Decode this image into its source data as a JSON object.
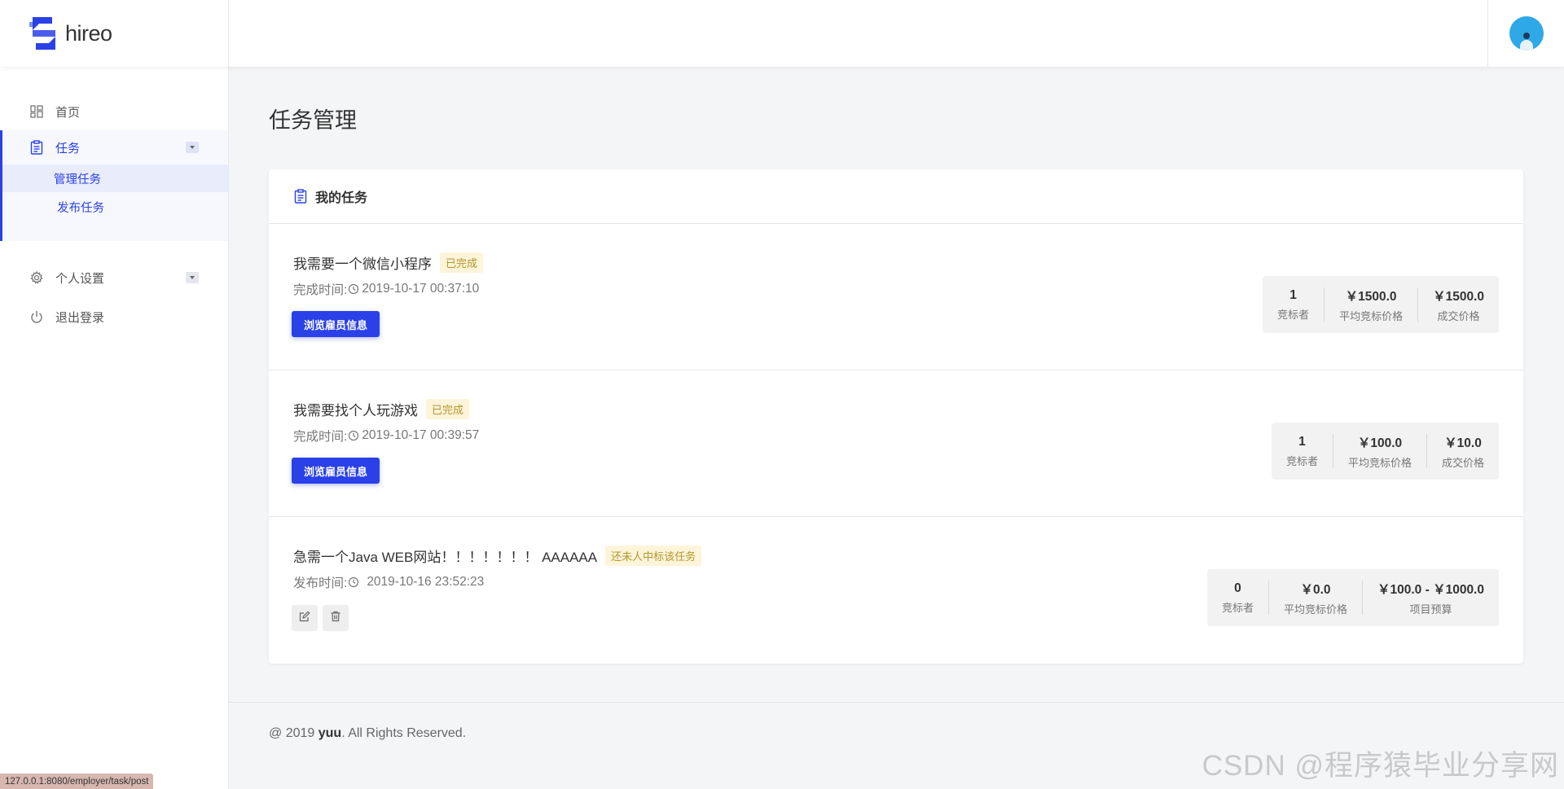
{
  "brand": {
    "name": "hireo",
    "accent": "#2a41e8"
  },
  "sidebar": {
    "home": "首页",
    "task": "任务",
    "task_sub": {
      "manage": "管理任务",
      "post": "发布任务"
    },
    "settings": "个人设置",
    "logout": "退出登录"
  },
  "page": {
    "title": "任务管理"
  },
  "panel": {
    "title": "我的任务"
  },
  "tasks": [
    {
      "name": "我需要一个微信小程序",
      "badge": "已完成",
      "time_label": "完成时间:",
      "time": "2019-10-17 00:37:10",
      "action": "浏览雇员信息",
      "stats": [
        {
          "value": "1",
          "label": "竞标者"
        },
        {
          "value": "￥1500.0",
          "label": "平均竞标价格"
        },
        {
          "value": "￥1500.0",
          "label": "成交价格"
        }
      ]
    },
    {
      "name": "我需要找个人玩游戏",
      "badge": "已完成",
      "time_label": "完成时间:",
      "time": "2019-10-17 00:39:57",
      "action": "浏览雇员信息",
      "stats": [
        {
          "value": "1",
          "label": "竞标者"
        },
        {
          "value": "￥100.0",
          "label": "平均竞标价格"
        },
        {
          "value": "￥10.0",
          "label": "成交价格"
        }
      ]
    },
    {
      "name": "急需一个Java WEB网站！！！！！！！ AAAAAA",
      "badge": "还未人中标该任务",
      "time_label": "发布时间:",
      "time": "2019-10-16 23:52:23",
      "stats": [
        {
          "value": "0",
          "label": "竞标者"
        },
        {
          "value": "￥0.0",
          "label": "平均竞标价格"
        },
        {
          "value": "￥100.0 - ￥1000.0",
          "label": "项目预算"
        }
      ]
    }
  ],
  "footer": {
    "prefix": "@ 2019 ",
    "author": "yuu",
    "suffix": ". All Rights Reserved."
  },
  "status_url": "127.0.0.1:8080/employer/task/post",
  "watermark": "CSDN @程序猿毕业分享网"
}
